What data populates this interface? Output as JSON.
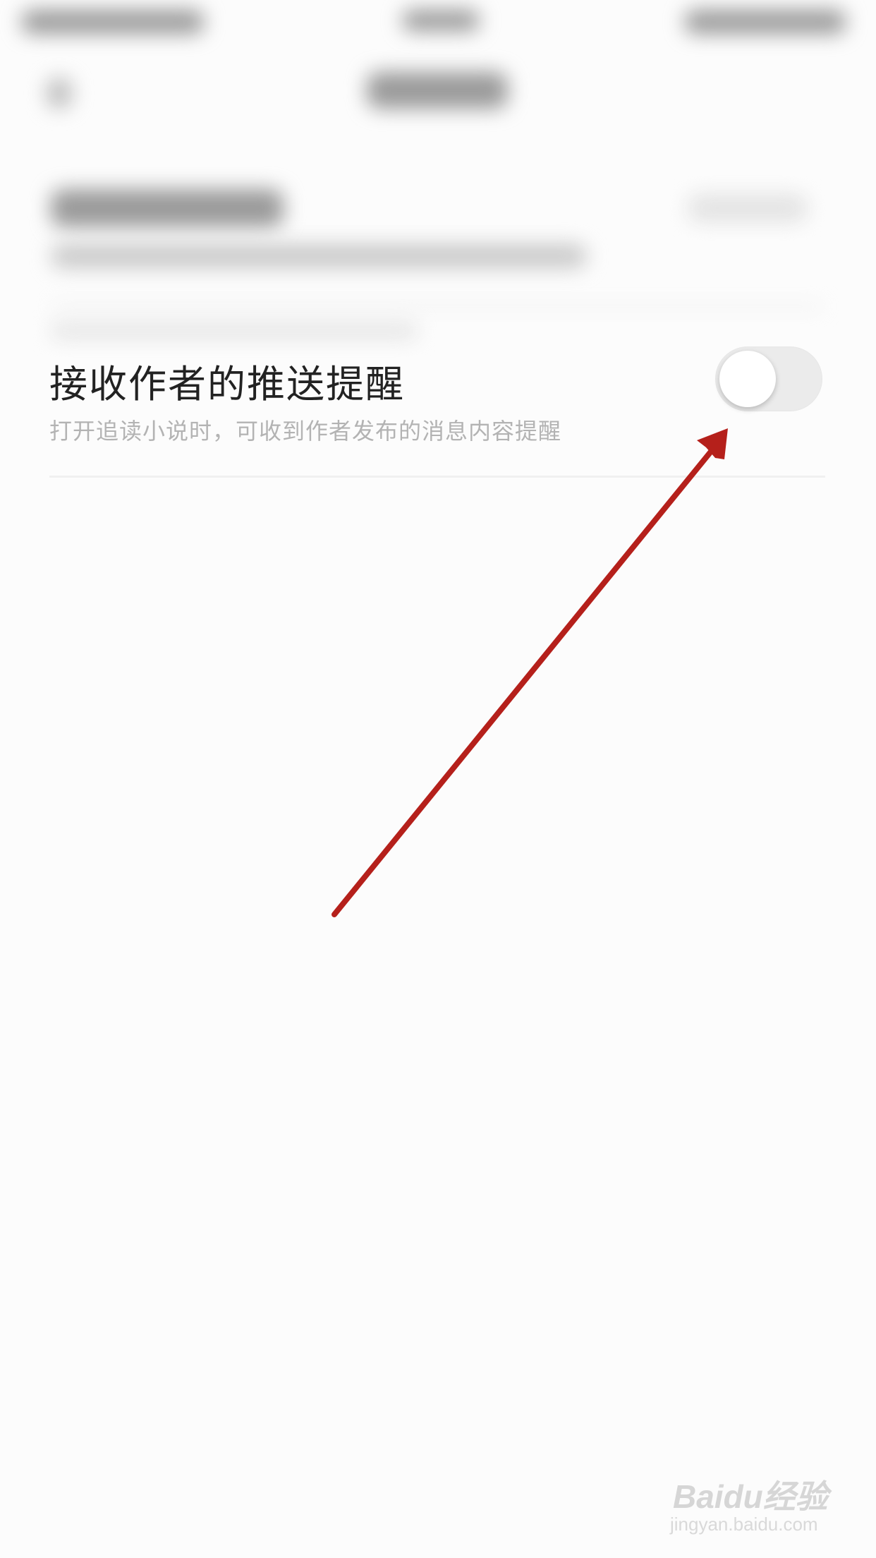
{
  "setting": {
    "title": "接收作者的推送提醒",
    "description": "打开追读小说时，可收到作者发布的消息内容提醒",
    "enabled": false
  },
  "colors": {
    "arrow": "#b5201b",
    "toggle_off_track": "#ebebeb",
    "title_text": "#222222",
    "description_text": "#b3b3b3"
  },
  "watermark": {
    "brand": "Baidu经验",
    "url": "jingyan.baidu.com"
  }
}
